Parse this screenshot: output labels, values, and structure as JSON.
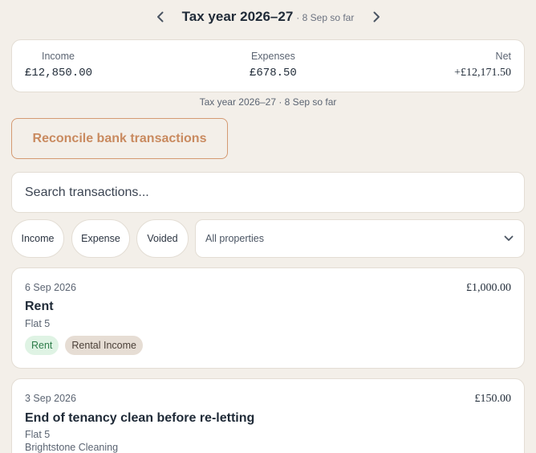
{
  "header": {
    "title": "Tax year 2026–27",
    "subtitle": "· 8 Sep so far",
    "prev_icon": "chevron-left-icon",
    "next_icon": "chevron-right-icon"
  },
  "summary": {
    "income_label": "Income",
    "income_value": "£12,850.00",
    "expenses_label": "Expenses",
    "expenses_value": "£678.50",
    "net_label": "Net",
    "net_value": "+£12,171.50",
    "caption": "Tax year 2026–27 · 8 Sep so far"
  },
  "actions": {
    "reconcile_label": "Reconcile bank transactions"
  },
  "search": {
    "placeholder": "Search transactions..."
  },
  "filters": {
    "chips": [
      "Income",
      "Expense",
      "Voided"
    ],
    "property_select": "All properties"
  },
  "transactions": [
    {
      "date": "6 Sep 2026",
      "title": "Rent",
      "property": "Flat 5",
      "amount": "£1,000.00",
      "tags": [
        "Rent",
        "Rental Income"
      ]
    },
    {
      "date": "3 Sep 2026",
      "title": "End of tenancy clean before re-letting",
      "property": "Flat 5",
      "payee": "Brightstone Cleaning",
      "amount": "£150.00"
    }
  ],
  "colors": {
    "background": "#f3efe9",
    "accent": "#c98a5f",
    "tag_green_bg": "#dff3e4",
    "tag_beige_bg": "#e6ddd4"
  }
}
